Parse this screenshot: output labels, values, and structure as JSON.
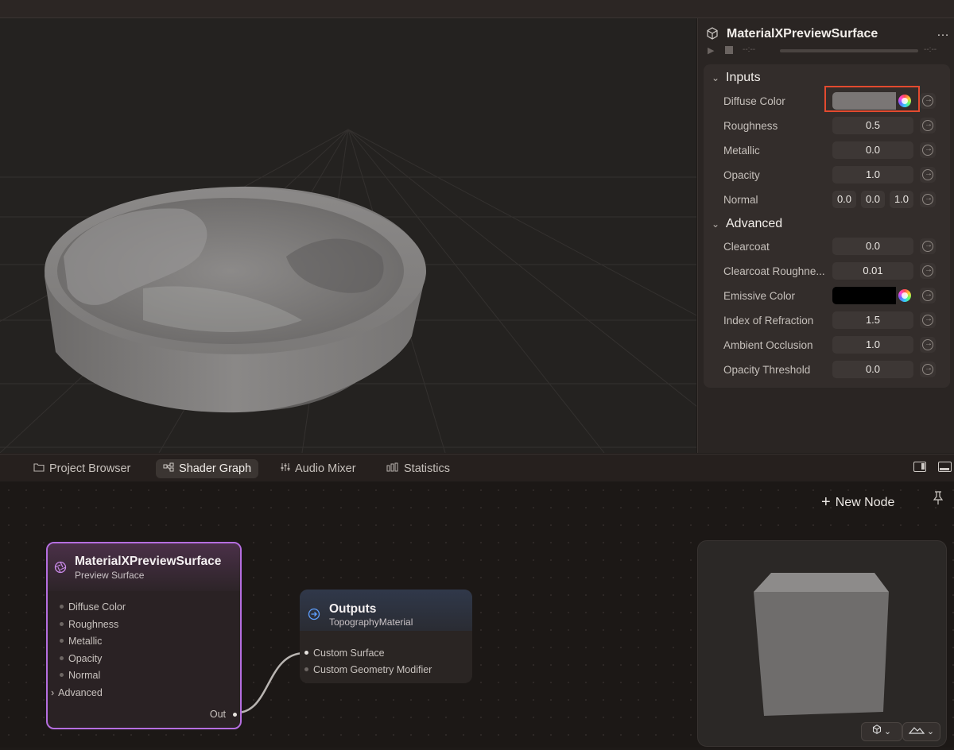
{
  "inspector": {
    "title": "MaterialXPreviewSurface",
    "more_label": "…",
    "time_left": "--:--",
    "time_right": "--:--",
    "inputs_section": "Inputs",
    "advanced_section": "Advanced",
    "inputs": [
      {
        "label": "Diffuse Color",
        "type": "color",
        "color": "#7a7675"
      },
      {
        "label": "Roughness",
        "value": "0.5"
      },
      {
        "label": "Metallic",
        "value": "0.0"
      },
      {
        "label": "Opacity",
        "value": "1.0"
      },
      {
        "label": "Normal",
        "values": [
          "0.0",
          "0.0",
          "1.0"
        ]
      }
    ],
    "advanced": [
      {
        "label": "Clearcoat",
        "value": "0.0"
      },
      {
        "label": "Clearcoat Roughne...",
        "value": "0.01"
      },
      {
        "label": "Emissive Color",
        "type": "color",
        "color": "#000000"
      },
      {
        "label": "Index of Refraction",
        "value": "1.5"
      },
      {
        "label": "Ambient Occlusion",
        "value": "1.0"
      },
      {
        "label": "Opacity Threshold",
        "value": "0.0"
      }
    ]
  },
  "tabs": [
    {
      "label": "Project Browser",
      "icon": "folder-icon"
    },
    {
      "label": "Shader Graph",
      "icon": "shader-graph-icon",
      "active": true
    },
    {
      "label": "Audio Mixer",
      "icon": "audio-mixer-icon"
    },
    {
      "label": "Statistics",
      "icon": "statistics-icon"
    }
  ],
  "graph": {
    "new_node_label": "New Node",
    "surface_node": {
      "title": "MaterialXPreviewSurface",
      "subtitle": "Preview Surface",
      "ports": [
        "Diffuse Color",
        "Roughness",
        "Metallic",
        "Opacity",
        "Normal"
      ],
      "advanced_label": "Advanced",
      "out_label": "Out"
    },
    "outputs_node": {
      "title": "Outputs",
      "subtitle": "TopographyMaterial",
      "ports": [
        "Custom Surface",
        "Custom Geometry Modifier"
      ]
    }
  },
  "colors": {
    "node_accent": "#b56ee0",
    "highlight": "#e34a2f"
  }
}
